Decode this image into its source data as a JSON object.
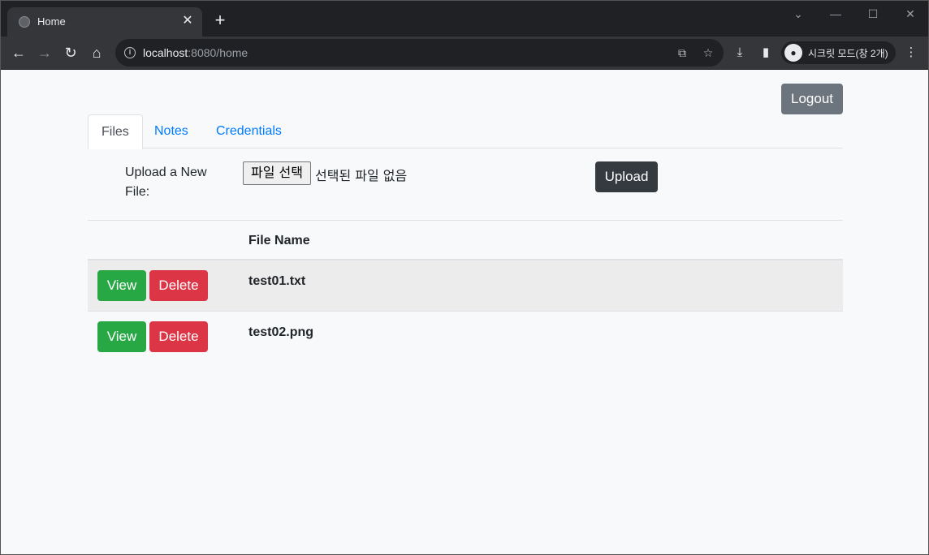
{
  "browser": {
    "tab_title": "Home",
    "tab_close": "✕",
    "new_tab": "+",
    "url_host": "localhost",
    "url_rest": ":8080/home",
    "incognito_label": "시크릿 모드(창 2개)",
    "icons": [
      "globe-icon",
      "back-icon",
      "forward-icon",
      "reload-icon",
      "home-icon",
      "info-icon",
      "translate-icon",
      "star-icon",
      "download-icon",
      "sidepanel-icon",
      "incognito-icon",
      "menu-icon"
    ]
  },
  "page": {
    "logout_label": "Logout",
    "tabs": [
      {
        "label": "Files",
        "active": true
      },
      {
        "label": "Notes",
        "active": false
      },
      {
        "label": "Credentials",
        "active": false
      }
    ],
    "upload": {
      "label": "Upload a New File:",
      "file_button": "파일 선택",
      "file_status": "선택된 파일 없음",
      "upload_button": "Upload"
    },
    "table": {
      "header_file_name": "File Name",
      "view_label": "View",
      "delete_label": "Delete",
      "rows": [
        {
          "file_name": "test01.txt"
        },
        {
          "file_name": "test02.png"
        }
      ]
    }
  },
  "colors": {
    "logout": "#6c757d",
    "upload": "#343a40",
    "view": "#28a745",
    "delete": "#dc3545",
    "link": "#007bff"
  }
}
